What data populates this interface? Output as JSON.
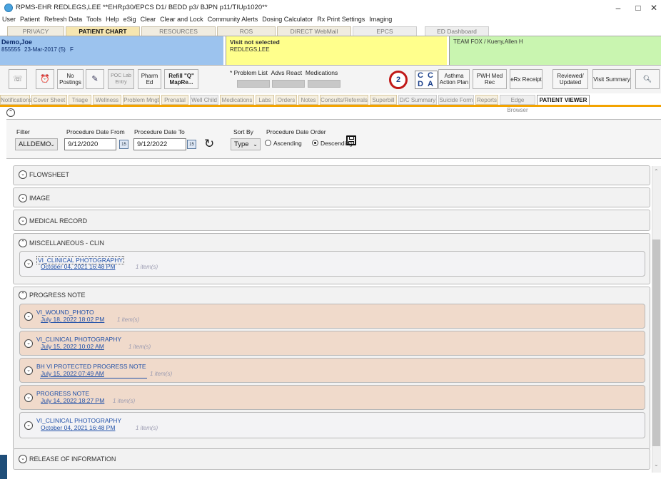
{
  "window": {
    "title": "RPMS-EHR REDLEGS,LEE   **EHRp30/EPCS D1/ BEDD p3/ BJPN p11/TIUp1020**",
    "controls": [
      "–",
      "□",
      "✕"
    ]
  },
  "menu": [
    "User",
    "Patient",
    "Refresh Data",
    "Tools",
    "Help",
    "eSig",
    "Clear",
    "Clear and Lock",
    "Community Alerts",
    "Dosing Calculator",
    "Rx Print Settings",
    "Imaging"
  ],
  "main_tabs": [
    "PRIVACY",
    "PATIENT CHART",
    "RESOURCES",
    "ROS",
    "DIRECT WebMail",
    "EPCS",
    "ED Dashboard"
  ],
  "patient": {
    "name": "Demo,Joe",
    "id": "855555",
    "dob": "23-Mar-2017 (5)",
    "sex": "F"
  },
  "visit": {
    "status": "Visit not selected",
    "provider": "REDLEGS,LEE"
  },
  "team": "TEAM FOX / Kueny,Allen H",
  "toolbar": {
    "no_postings": "No Postings",
    "poc_lab": "POC Lab Entry",
    "pham_ed": "Pharm Ed",
    "refill": "Refill \"Q\" MapRe...",
    "problem_list": "* Problem List",
    "advs_react": "Advs React",
    "medications": "Medications",
    "cd_labels": [
      "C",
      "C",
      "D",
      "A"
    ],
    "asthma": "Asthma Action Plan",
    "pwh": "PWH Med Rec",
    "erx": "eRx Receipt",
    "reviewed": "Reviewed/ Updated",
    "visit_summary": "Visit Summary"
  },
  "sub_tabs": [
    "Notifications",
    "Cover Sheet",
    "Triage",
    "Wellness",
    "Problem Mngt",
    "Prenatal",
    "Well Child",
    "Medications",
    "Labs",
    "Orders",
    "Notes",
    "Consults/Referrals",
    "Superbill",
    "D/C Summary",
    "Suicide Form",
    "Reports",
    "Edge Browser",
    "PATIENT VIEWER"
  ],
  "filter": {
    "filter_label": "Filter",
    "filter_value": "ALLDEMO",
    "from_label": "Procedure Date From",
    "from_value": "9/12/2020",
    "to_label": "Procedure Date To",
    "to_value": "9/12/2022",
    "sort_label": "Sort By",
    "sort_value": "Type",
    "order_label": "Procedure Date Order",
    "ascending": "Ascending",
    "descending": "Descending",
    "selected_order": "Descending",
    "cal_glyph": "15"
  },
  "sections": {
    "flowsheet": "FLOWSHEET",
    "image": "IMAGE",
    "medical_record": "MEDICAL RECORD",
    "misc": "MISCELLANEOUS - CLIN",
    "progress": "PROGRESS NOTE",
    "release": "RELEASE OF INFORMATION"
  },
  "misc_items": [
    {
      "name": "VI_CLINICAL PHOTOGRAPHY",
      "date": "October 04, 2021 16:48 PM",
      "count": "1 item(s)"
    }
  ],
  "progress_items": [
    {
      "name": "VI_WOUND_PHOTO",
      "date": "July 18, 2022 18:02 PM",
      "count": "1 item(s)"
    },
    {
      "name": "VI_CLINICAL PHOTOGRAPHY",
      "date": "July 15, 2022 10:02 AM",
      "count": "1 item(s)"
    },
    {
      "name": "BH VI PROTECTED PROGRESS NOTE",
      "date": "July 15, 2022 07:49 AM",
      "count": "1 item(s)"
    },
    {
      "name": "PROGRESS NOTE",
      "date": "July 14, 2022 18:27 PM",
      "count": "1 item(s)"
    },
    {
      "name": "VI_CLINICAL PHOTOGRAPHY",
      "date": "October 04, 2021 16:48 PM",
      "count": "1 item(s)"
    }
  ],
  "colors": {
    "patient_bg": "#9cc3ee",
    "visit_bg": "#ffff8c",
    "team_bg": "#c9f5b0",
    "accent_line": "#f3a300",
    "item_tan": "#f0dacb",
    "link_blue": "#2050a8"
  }
}
